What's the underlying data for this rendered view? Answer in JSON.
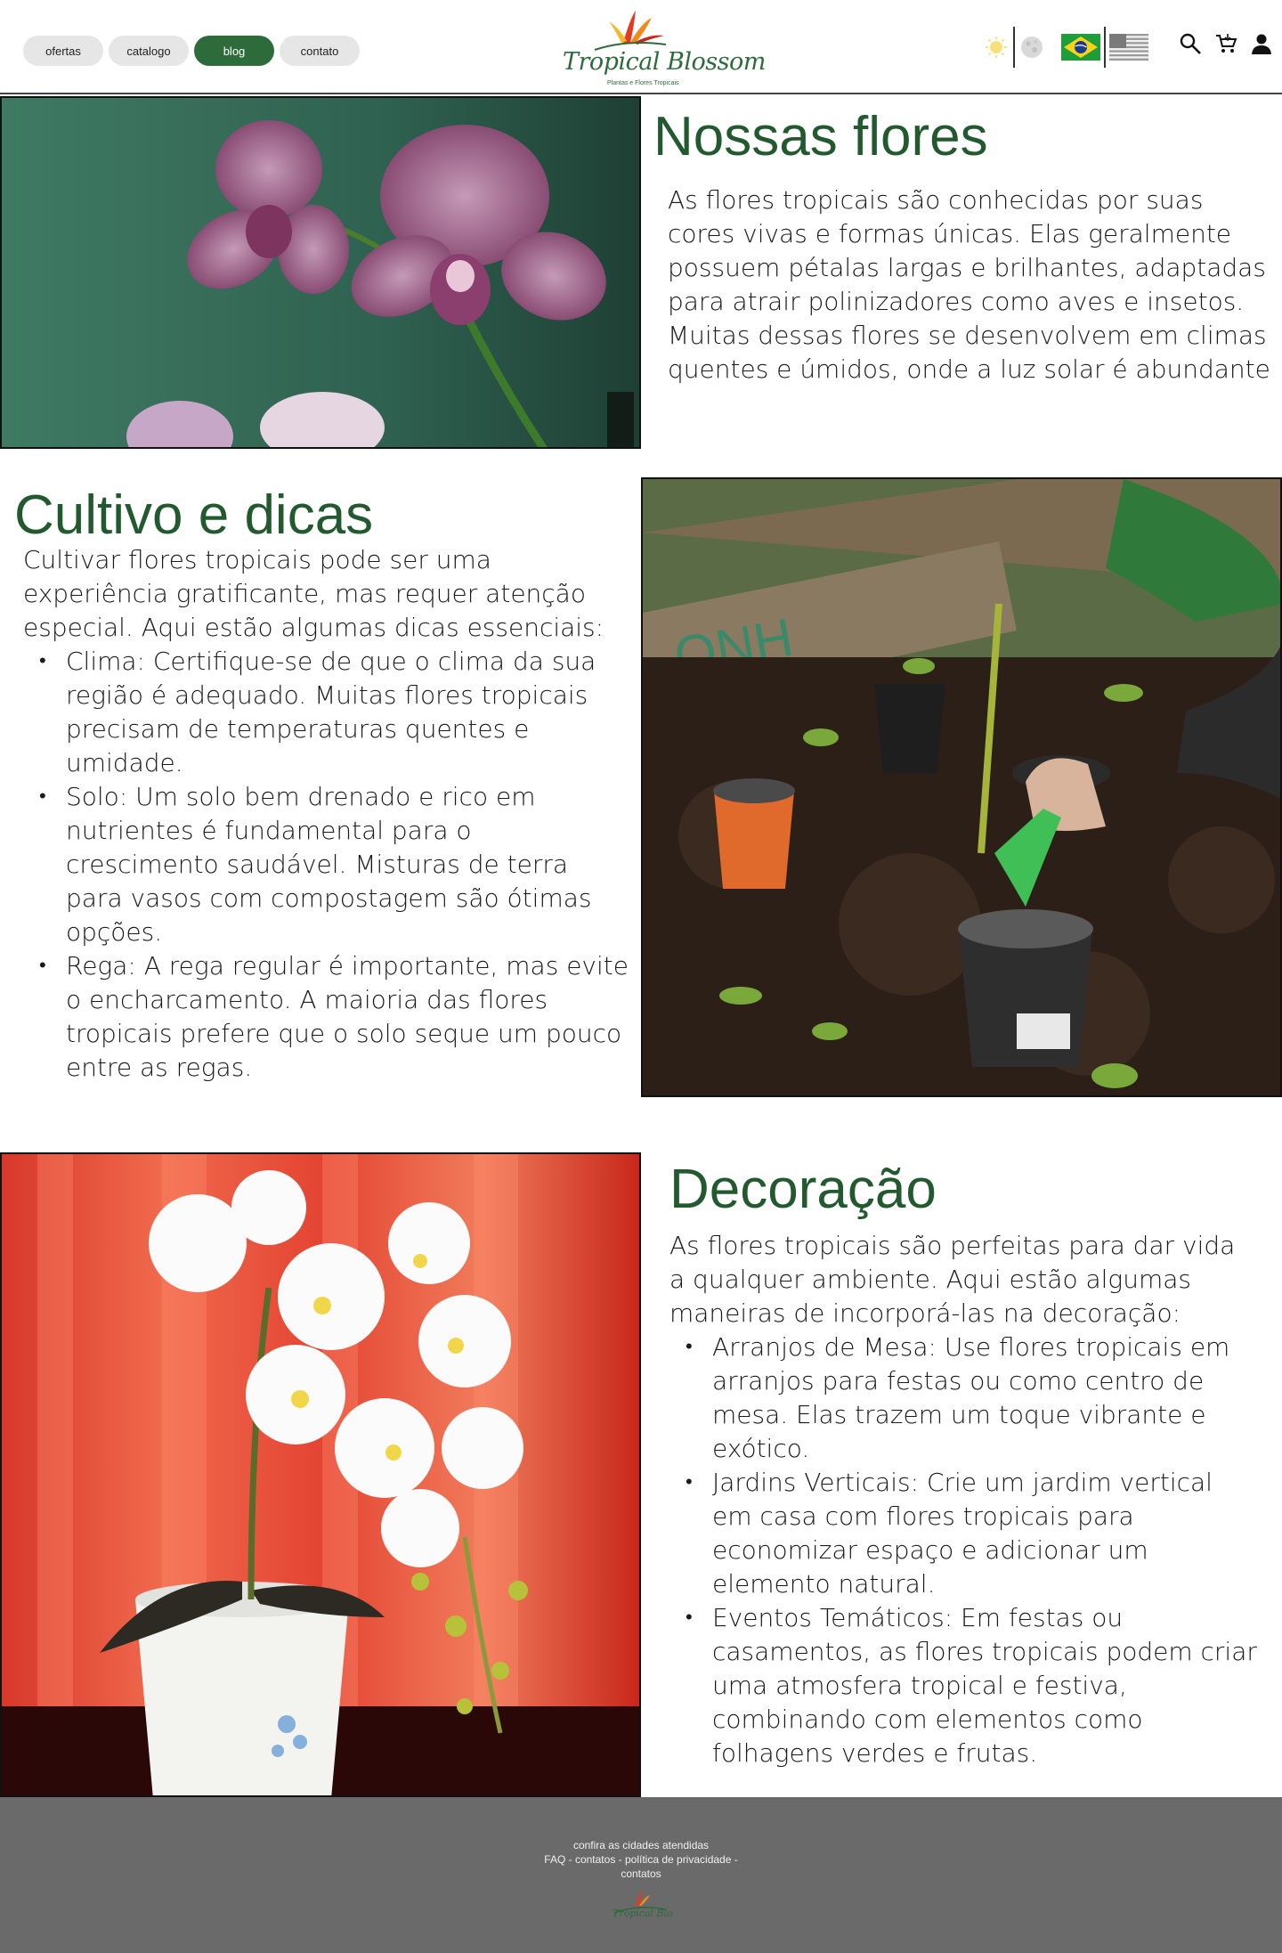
{
  "header": {
    "nav": [
      {
        "label": "ofertas",
        "active": false
      },
      {
        "label": "catalogo",
        "active": false
      },
      {
        "label": "blog",
        "active": true
      },
      {
        "label": "contato",
        "active": false
      }
    ],
    "logo_title": "Tropical Blossom",
    "logo_subtitle": "Plantas e Flores Tropicais",
    "icons": [
      "sun-icon",
      "moon-icon",
      "brazil-flag-icon",
      "usa-flag-icon",
      "search-icon",
      "cart-icon",
      "user-icon"
    ]
  },
  "colors": {
    "brand_green": "#2e6b3a",
    "title_green": "#23592f",
    "footer_gray": "#6a6a6a"
  },
  "sections": {
    "nossas_flores": {
      "title": "Nossas flores",
      "paragraph": "As flores tropicais são conhecidas por suas cores vivas e formas únicas. Elas geralmente possuem pétalas largas e brilhantes, adaptadas para atrair polinizadores como aves e insetos. Muitas dessas flores se desenvolvem em climas quentes e úmidos, onde a luz solar é abundante"
    },
    "cultivo": {
      "title": "Cultivo e dicas",
      "intro": "Cultivar flores tropicais pode ser uma experiência gratificante, mas requer atenção especial. Aqui estão algumas dicas essenciais:",
      "items": [
        "Clima: Certifique-se de que o clima da sua região é adequado. Muitas flores tropicais precisam de temperaturas quentes e umidade.",
        "Solo: Um solo bem drenado e rico em nutrientes é fundamental para o crescimento saudável. Misturas de terra para vasos com compostagem são ótimas opções.",
        "Rega: A rega regular é importante, mas evite o encharcamento. A maioria das flores tropicais prefere que o solo seque um pouco entre as regas."
      ]
    },
    "decoracao": {
      "title": "Decoração",
      "intro": "As flores tropicais são perfeitas para dar vida a qualquer ambiente. Aqui estão algumas maneiras de incorporá-las na decoração:",
      "items": [
        "Arranjos de Mesa: Use flores tropicais em arranjos para festas ou como centro de mesa. Elas trazem um toque vibrante e exótico.",
        "Jardins Verticais: Crie um jardim vertical em casa com flores tropicais para economizar espaço e adicionar um elemento natural.",
        "Eventos Temáticos: Em festas ou casamentos, as flores tropicais podem criar uma atmosfera tropical e festiva, combinando com elementos como folhagens verdes e frutas."
      ]
    }
  },
  "footer": {
    "line1": "confira as cidades atendidas",
    "line2": "FAQ - contatos - política de privacidade - contatos"
  }
}
